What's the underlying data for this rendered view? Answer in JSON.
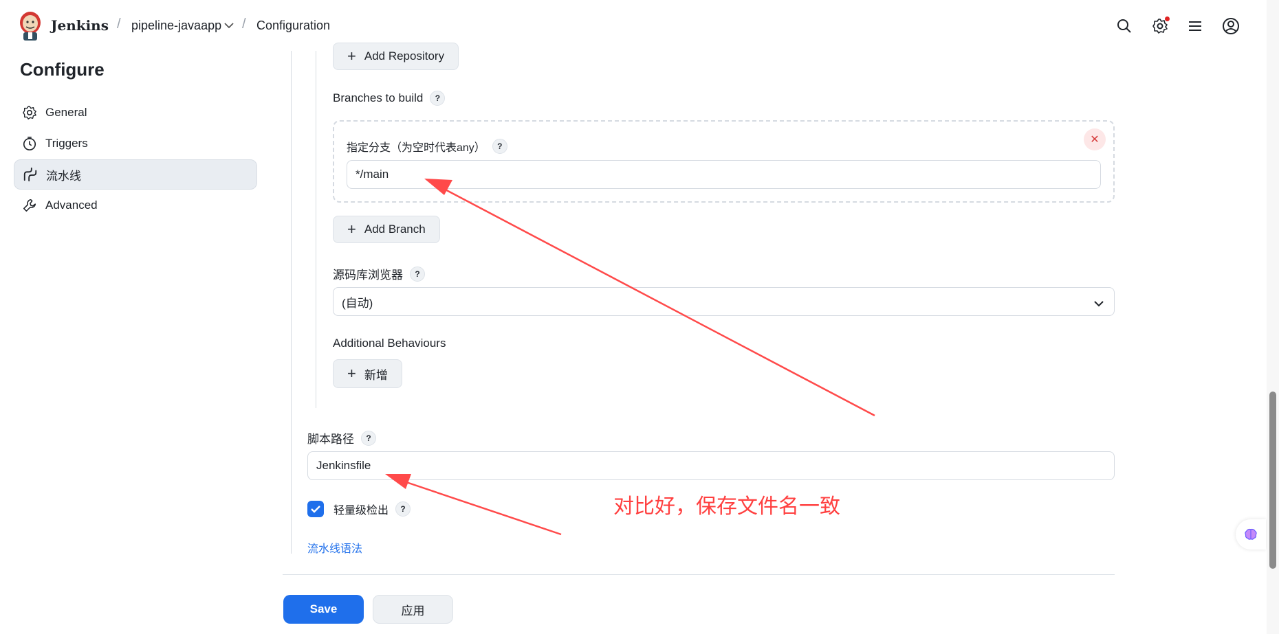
{
  "header": {
    "brand": "Jenkins",
    "breadcrumb_job": "pipeline-javaapp",
    "breadcrumb_page": "Configuration",
    "icons": [
      "search-icon",
      "gear-icon",
      "menu-icon",
      "user-icon"
    ]
  },
  "sidebar": {
    "title": "Configure",
    "items": [
      {
        "label": "General",
        "icon": "gear-icon"
      },
      {
        "label": "Triggers",
        "icon": "clock-icon"
      },
      {
        "label": "流水线",
        "icon": "pipeline-icon"
      },
      {
        "label": "Advanced",
        "icon": "wrench-icon"
      }
    ]
  },
  "scm": {
    "add_repository": "Add Repository",
    "branches_label": "Branches to build",
    "branch_spec_label": "指定分支（为空时代表any）",
    "branch_spec_value": "*/main",
    "add_branch": "Add Branch",
    "browser_label": "源码库浏览器",
    "browser_value": "(自动)",
    "behaviours_label": "Additional Behaviours",
    "add_behaviour": "新增"
  },
  "script": {
    "path_label": "脚本路径",
    "path_value": "Jenkinsfile",
    "lightweight_label": "轻量级检出",
    "lightweight_checked": true,
    "syntax_link": "流水线语法"
  },
  "annotation": {
    "text": "对比好，保存文件名一致",
    "color": "#ff4040"
  },
  "footer": {
    "save": "Save",
    "apply": "应用"
  },
  "help_glyph": "?",
  "colors": {
    "primary": "#1f6feb",
    "annotation": "#ff4040"
  }
}
